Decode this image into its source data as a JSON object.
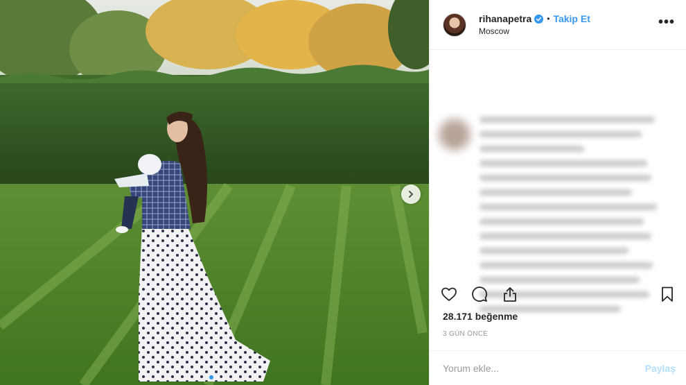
{
  "post": {
    "image_alt": "Woman in tweed jacket and polka-dot skirt holding baby on lawn"
  },
  "header": {
    "username": "rihanapetra",
    "verified": true,
    "separator": "•",
    "follow_label": "Takip Et",
    "location": "Moscow",
    "more_label": "•••"
  },
  "actions": {
    "like_icon": "heart-icon",
    "comment_icon": "comment-icon",
    "share_icon": "share-icon",
    "save_icon": "bookmark-icon"
  },
  "likes_text": "28.171 beğenme",
  "time_text": "3 GÜN ÖNCE",
  "comment": {
    "placeholder": "Yorum ekle...",
    "post_label": "Paylaş"
  },
  "carousel": {
    "count": 2,
    "active_index": 0
  },
  "colors": {
    "accent": "#3897f0",
    "post_disabled": "#b2dffc",
    "muted": "#999999"
  }
}
